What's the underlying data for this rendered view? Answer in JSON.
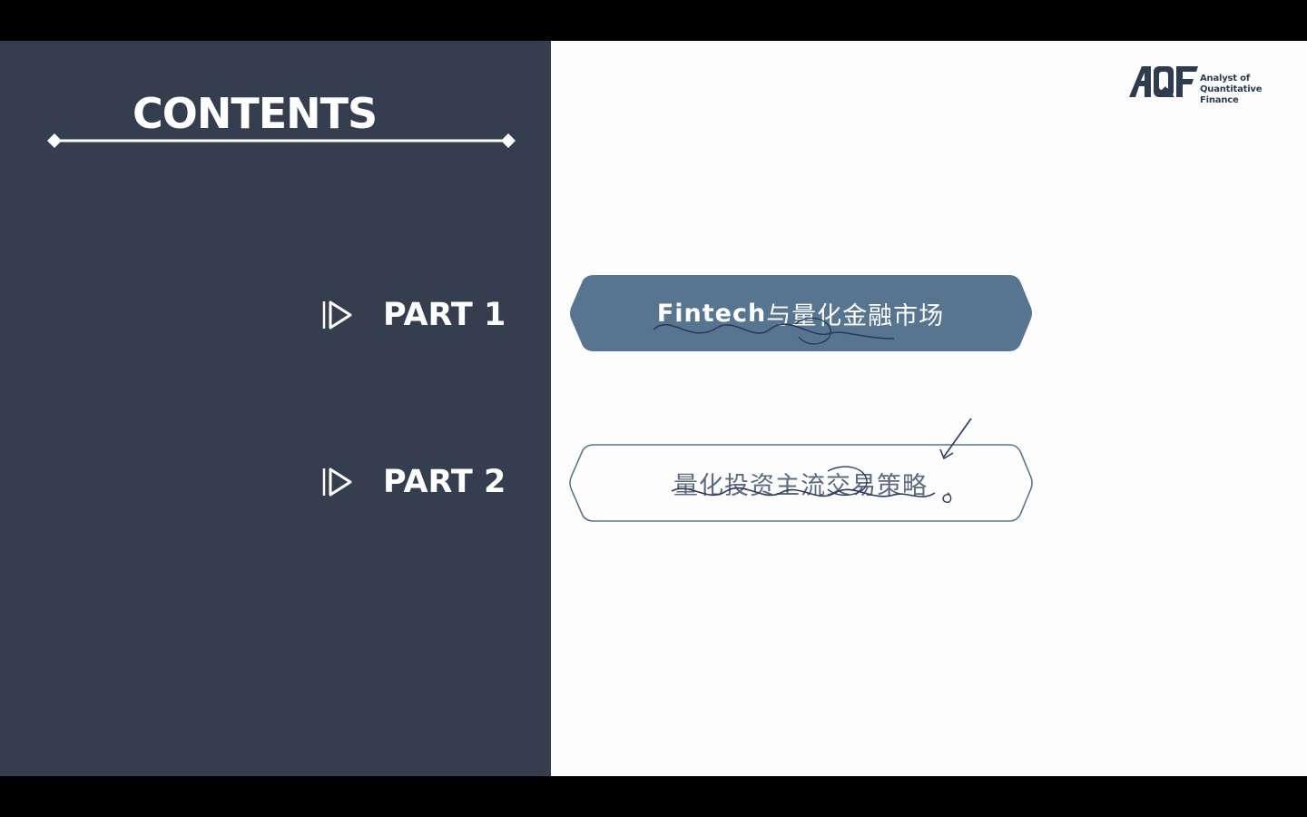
{
  "slide": {
    "title": "CONTENTS",
    "logo": {
      "mark": "AQF",
      "line1": "Analyst of",
      "line2": "Quantitative Finance"
    },
    "parts": [
      {
        "label": "PART 1",
        "icon": "play-outline-icon",
        "banner": {
          "latin": "Fintech",
          "cjk": "与量化金融市场"
        }
      },
      {
        "label": "PART 2",
        "icon": "play-outline-icon",
        "banner": {
          "latin": "",
          "cjk": "量化投资主流交易策略"
        }
      }
    ]
  },
  "colors": {
    "left_panel": "#343e4f",
    "banner_fill": "#577491",
    "banner_outline": "#5a7691",
    "page_background": "#fdfdfd",
    "letterbox": "#000000",
    "annotation_ink": "#2b3a5c"
  }
}
